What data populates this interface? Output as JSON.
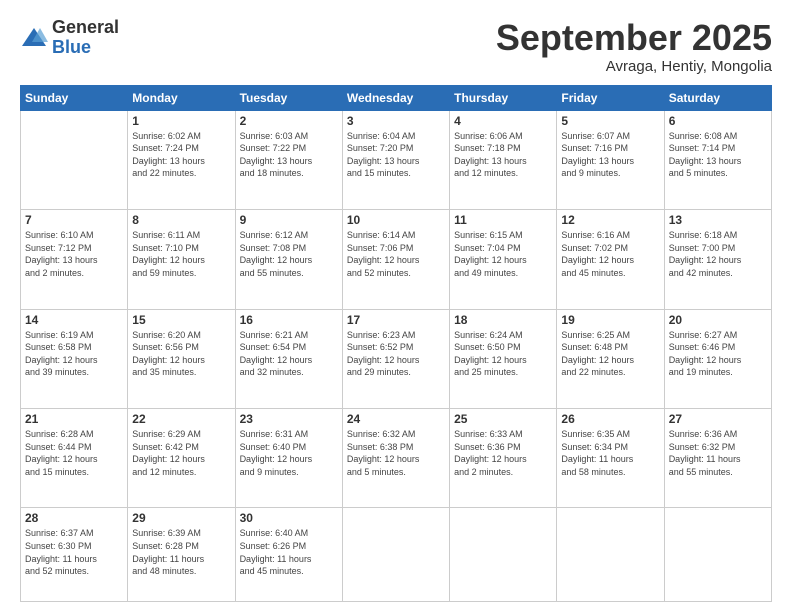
{
  "logo": {
    "general": "General",
    "blue": "Blue"
  },
  "header": {
    "month": "September 2025",
    "location": "Avraga, Hentiy, Mongolia"
  },
  "weekdays": [
    "Sunday",
    "Monday",
    "Tuesday",
    "Wednesday",
    "Thursday",
    "Friday",
    "Saturday"
  ],
  "weeks": [
    [
      {
        "day": "",
        "info": ""
      },
      {
        "day": "1",
        "info": "Sunrise: 6:02 AM\nSunset: 7:24 PM\nDaylight: 13 hours\nand 22 minutes."
      },
      {
        "day": "2",
        "info": "Sunrise: 6:03 AM\nSunset: 7:22 PM\nDaylight: 13 hours\nand 18 minutes."
      },
      {
        "day": "3",
        "info": "Sunrise: 6:04 AM\nSunset: 7:20 PM\nDaylight: 13 hours\nand 15 minutes."
      },
      {
        "day": "4",
        "info": "Sunrise: 6:06 AM\nSunset: 7:18 PM\nDaylight: 13 hours\nand 12 minutes."
      },
      {
        "day": "5",
        "info": "Sunrise: 6:07 AM\nSunset: 7:16 PM\nDaylight: 13 hours\nand 9 minutes."
      },
      {
        "day": "6",
        "info": "Sunrise: 6:08 AM\nSunset: 7:14 PM\nDaylight: 13 hours\nand 5 minutes."
      }
    ],
    [
      {
        "day": "7",
        "info": "Sunrise: 6:10 AM\nSunset: 7:12 PM\nDaylight: 13 hours\nand 2 minutes."
      },
      {
        "day": "8",
        "info": "Sunrise: 6:11 AM\nSunset: 7:10 PM\nDaylight: 12 hours\nand 59 minutes."
      },
      {
        "day": "9",
        "info": "Sunrise: 6:12 AM\nSunset: 7:08 PM\nDaylight: 12 hours\nand 55 minutes."
      },
      {
        "day": "10",
        "info": "Sunrise: 6:14 AM\nSunset: 7:06 PM\nDaylight: 12 hours\nand 52 minutes."
      },
      {
        "day": "11",
        "info": "Sunrise: 6:15 AM\nSunset: 7:04 PM\nDaylight: 12 hours\nand 49 minutes."
      },
      {
        "day": "12",
        "info": "Sunrise: 6:16 AM\nSunset: 7:02 PM\nDaylight: 12 hours\nand 45 minutes."
      },
      {
        "day": "13",
        "info": "Sunrise: 6:18 AM\nSunset: 7:00 PM\nDaylight: 12 hours\nand 42 minutes."
      }
    ],
    [
      {
        "day": "14",
        "info": "Sunrise: 6:19 AM\nSunset: 6:58 PM\nDaylight: 12 hours\nand 39 minutes."
      },
      {
        "day": "15",
        "info": "Sunrise: 6:20 AM\nSunset: 6:56 PM\nDaylight: 12 hours\nand 35 minutes."
      },
      {
        "day": "16",
        "info": "Sunrise: 6:21 AM\nSunset: 6:54 PM\nDaylight: 12 hours\nand 32 minutes."
      },
      {
        "day": "17",
        "info": "Sunrise: 6:23 AM\nSunset: 6:52 PM\nDaylight: 12 hours\nand 29 minutes."
      },
      {
        "day": "18",
        "info": "Sunrise: 6:24 AM\nSunset: 6:50 PM\nDaylight: 12 hours\nand 25 minutes."
      },
      {
        "day": "19",
        "info": "Sunrise: 6:25 AM\nSunset: 6:48 PM\nDaylight: 12 hours\nand 22 minutes."
      },
      {
        "day": "20",
        "info": "Sunrise: 6:27 AM\nSunset: 6:46 PM\nDaylight: 12 hours\nand 19 minutes."
      }
    ],
    [
      {
        "day": "21",
        "info": "Sunrise: 6:28 AM\nSunset: 6:44 PM\nDaylight: 12 hours\nand 15 minutes."
      },
      {
        "day": "22",
        "info": "Sunrise: 6:29 AM\nSunset: 6:42 PM\nDaylight: 12 hours\nand 12 minutes."
      },
      {
        "day": "23",
        "info": "Sunrise: 6:31 AM\nSunset: 6:40 PM\nDaylight: 12 hours\nand 9 minutes."
      },
      {
        "day": "24",
        "info": "Sunrise: 6:32 AM\nSunset: 6:38 PM\nDaylight: 12 hours\nand 5 minutes."
      },
      {
        "day": "25",
        "info": "Sunrise: 6:33 AM\nSunset: 6:36 PM\nDaylight: 12 hours\nand 2 minutes."
      },
      {
        "day": "26",
        "info": "Sunrise: 6:35 AM\nSunset: 6:34 PM\nDaylight: 11 hours\nand 58 minutes."
      },
      {
        "day": "27",
        "info": "Sunrise: 6:36 AM\nSunset: 6:32 PM\nDaylight: 11 hours\nand 55 minutes."
      }
    ],
    [
      {
        "day": "28",
        "info": "Sunrise: 6:37 AM\nSunset: 6:30 PM\nDaylight: 11 hours\nand 52 minutes."
      },
      {
        "day": "29",
        "info": "Sunrise: 6:39 AM\nSunset: 6:28 PM\nDaylight: 11 hours\nand 48 minutes."
      },
      {
        "day": "30",
        "info": "Sunrise: 6:40 AM\nSunset: 6:26 PM\nDaylight: 11 hours\nand 45 minutes."
      },
      {
        "day": "",
        "info": ""
      },
      {
        "day": "",
        "info": ""
      },
      {
        "day": "",
        "info": ""
      },
      {
        "day": "",
        "info": ""
      }
    ]
  ]
}
